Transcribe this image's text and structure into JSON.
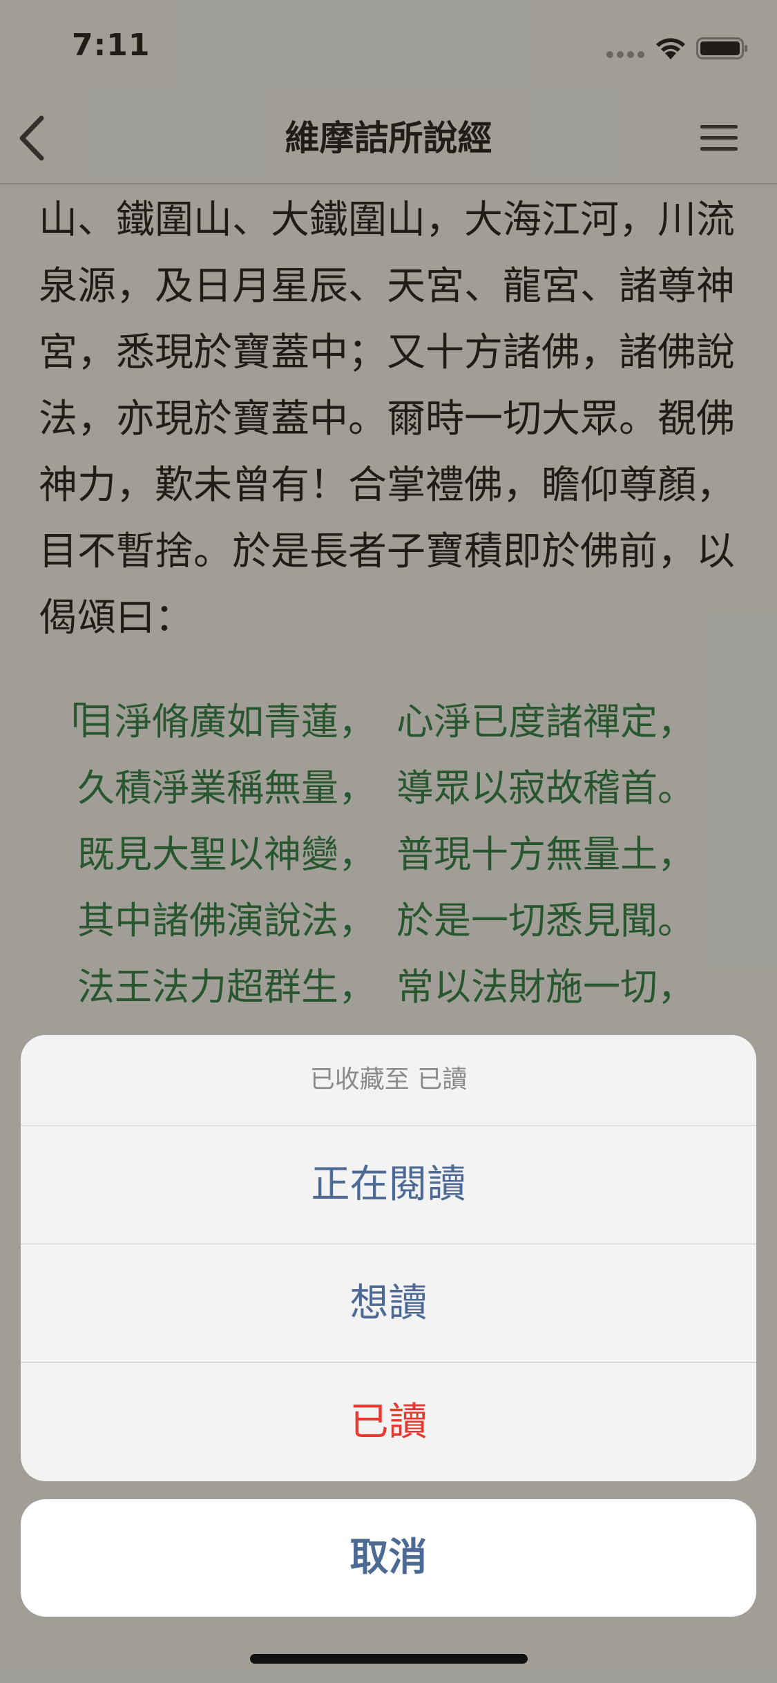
{
  "status_bar": {
    "time": "7:11"
  },
  "nav": {
    "title": "維摩詰所說經"
  },
  "reader": {
    "prose_lines": [
      "山、鐵圍山、大鐵圍山，大海江河，川流",
      "泉源，及日月星辰、天宮、龍宮、諸尊神",
      "宮，悉現於寶蓋中；又十方諸佛，諸佛說",
      "法，亦現於寶蓋中。爾時一切大眾。覩佛",
      "神力，歎未曾有！合掌禮佛，瞻仰尊顏，",
      "目不暫捨。於是長者子寶積即於佛前，以",
      "偈頌曰："
    ],
    "verse_open_quote": "「",
    "verses": [
      {
        "a": "目淨脩廣如青蓮，",
        "b": "心淨已度諸禪定，"
      },
      {
        "a": "久積淨業稱無量，",
        "b": "導眾以寂故稽首。"
      },
      {
        "a": "既見大聖以神變，",
        "b": "普現十方無量土，"
      },
      {
        "a": "其中諸佛演說法，",
        "b": "於是一切悉見聞。"
      },
      {
        "a": "法王法力超群生，",
        "b": "常以法財施一切，"
      }
    ]
  },
  "action_sheet": {
    "title": "已收藏至 已讀",
    "options": [
      {
        "label": "正在閱讀",
        "style": "default"
      },
      {
        "label": "想讀",
        "style": "default"
      },
      {
        "label": "已讀",
        "style": "destructive"
      }
    ],
    "cancel_label": "取消"
  },
  "colors": {
    "accent": "#4d6a94",
    "destructive": "#e8382f",
    "verse_text": "#1f7a3a"
  }
}
